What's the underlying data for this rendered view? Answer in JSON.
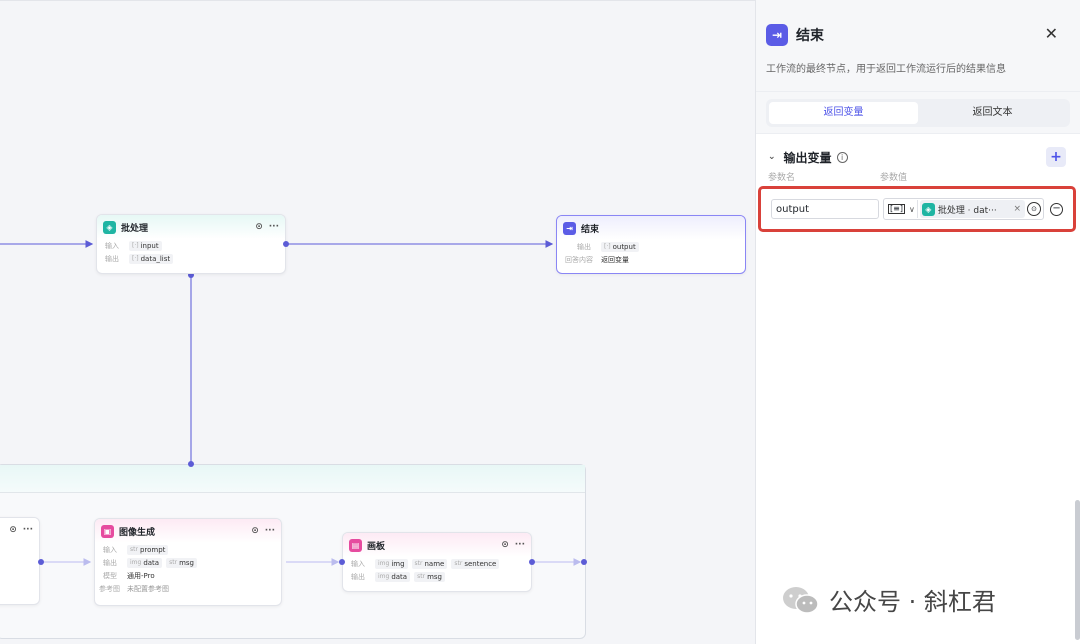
{
  "panel": {
    "title": "结束",
    "description": "工作流的最终节点，用于返回工作流运行后的结果信息",
    "close_icon": "close-icon",
    "tabs": [
      {
        "label": "返回变量",
        "active": true
      },
      {
        "label": "返回文本",
        "active": false
      }
    ],
    "section_title": "输出变量",
    "col_param_name": "参数名",
    "col_param_value": "参数值",
    "row": {
      "name_value": "output",
      "ref_label": "批处理 · dat···"
    }
  },
  "nodes": {
    "batch": {
      "title": "批处理",
      "input_label": "输入",
      "input_chip": "input",
      "output_label": "输出",
      "output_chip": "data_list"
    },
    "end": {
      "title": "结束",
      "output_label": "输出",
      "output_chip": "output",
      "answer_label": "回答内容",
      "answer_value": "返回变量"
    },
    "image_gen": {
      "title": "图像生成",
      "input_label": "输入",
      "input_chip": "prompt",
      "output_label": "输出",
      "output_chip1": "data",
      "output_chip2": "msg",
      "model_label": "模型",
      "model_value": "通用-Pro",
      "ref_label": "参考图",
      "ref_value": "未配置参考图"
    },
    "canvas_node": {
      "title": "画板",
      "input_label": "输入",
      "input_chip1": "img",
      "input_chip2": "name",
      "input_chip3": "sentence",
      "output_label": "输出",
      "output_chip1": "data",
      "output_chip2": "msg"
    }
  },
  "watermark": "公众号 · 斜杠君",
  "colors": {
    "accent": "#4d53e8",
    "highlight": "#d9413a",
    "batch": "#1fb5a3",
    "image": "#e64b9f",
    "end": "#5b5ce6"
  }
}
